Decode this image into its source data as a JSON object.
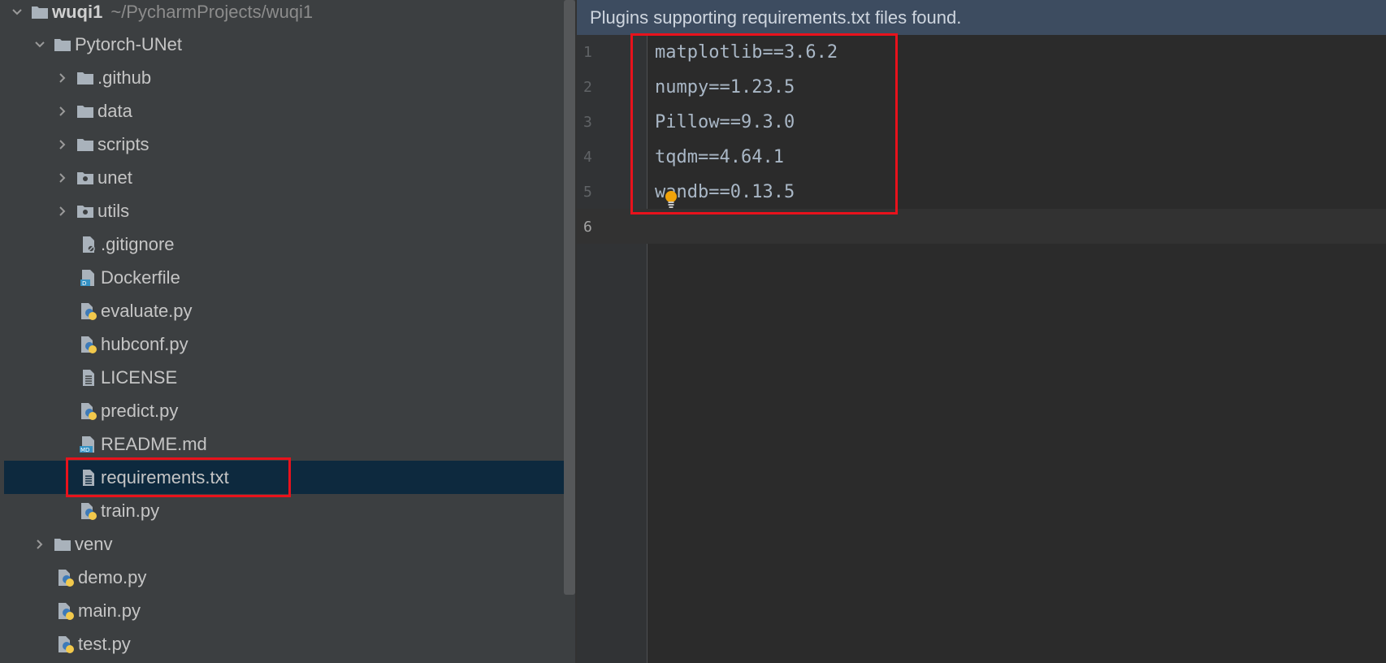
{
  "project_tree": {
    "root": {
      "name": "wuqi1",
      "path": "~/PycharmProjects/wuqi1"
    },
    "items": [
      {
        "label": "Pytorch-UNet",
        "kind": "folder",
        "expanded": true
      },
      {
        "label": ".github",
        "kind": "folder"
      },
      {
        "label": "data",
        "kind": "folder"
      },
      {
        "label": "scripts",
        "kind": "folder"
      },
      {
        "label": "unet",
        "kind": "package"
      },
      {
        "label": "utils",
        "kind": "package"
      },
      {
        "label": ".gitignore",
        "kind": "ignore-file"
      },
      {
        "label": "Dockerfile",
        "kind": "docker-file"
      },
      {
        "label": "evaluate.py",
        "kind": "python-file"
      },
      {
        "label": "hubconf.py",
        "kind": "python-file"
      },
      {
        "label": "LICENSE",
        "kind": "text-file"
      },
      {
        "label": "predict.py",
        "kind": "python-file"
      },
      {
        "label": "README.md",
        "kind": "markdown-file"
      },
      {
        "label": "requirements.txt",
        "kind": "text-file",
        "selected": true
      },
      {
        "label": "train.py",
        "kind": "python-file"
      },
      {
        "label": "venv",
        "kind": "folder"
      },
      {
        "label": "demo.py",
        "kind": "python-file"
      },
      {
        "label": "main.py",
        "kind": "python-file"
      },
      {
        "label": "test.py",
        "kind": "python-file"
      }
    ]
  },
  "editor": {
    "banner": "Plugins supporting requirements.txt files found.",
    "line_numbers": [
      "1",
      "2",
      "3",
      "4",
      "5",
      "6"
    ],
    "lines": [
      "matplotlib==3.6.2",
      "numpy==1.23.5",
      "Pillow==9.3.0",
      "tqdm==4.64.1",
      "wandb==0.13.5",
      ""
    ],
    "current_line": 6
  },
  "colors": {
    "highlight": "#e8121c",
    "selection": "#0d293e",
    "banner": "#3d4c60",
    "bulb": "#f0a30a"
  }
}
